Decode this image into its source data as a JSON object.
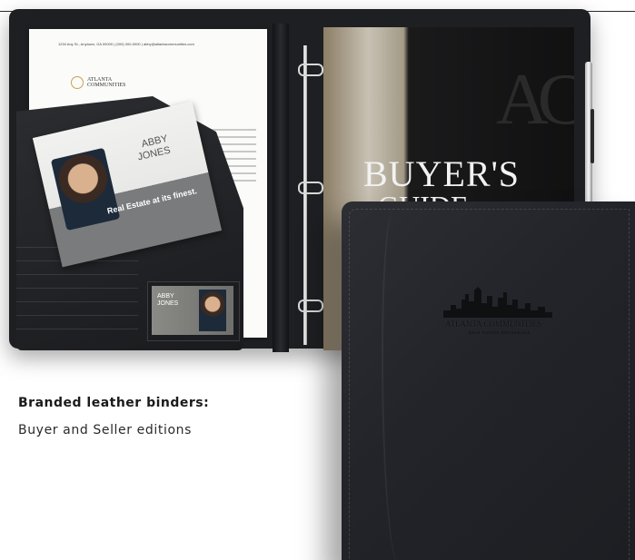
{
  "caption": {
    "title": "Branded leather binders:",
    "subtitle": "Buyer and Seller editions"
  },
  "letterhead": {
    "contact_line": "1234 Any St., Anytown, GA 00000  |  (000) 000-0000  |  abby@atlantacommunities.com",
    "brand": "ATLANTA\nCOMMUNITIES"
  },
  "business_card": {
    "name": "ABBY\nJONES",
    "tagline": "Real Estate at its finest."
  },
  "id_card": {
    "name": "ABBY\nJONES"
  },
  "guide": {
    "monogram": "AC",
    "title": "BUYER'S",
    "subtitle": "GUIDE"
  },
  "cover": {
    "brand": "ATLANTA COMMUNITIES",
    "sub": "REAL ESTATE BROKERAGE"
  },
  "colors": {
    "leather": "#22242a",
    "accent_gold": "#c9a24a"
  }
}
